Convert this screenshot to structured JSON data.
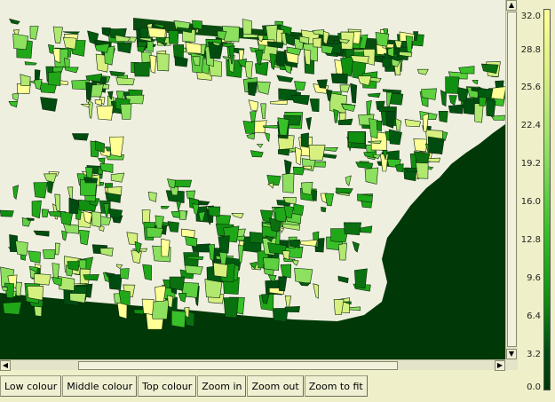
{
  "legend": {
    "ticks": [
      "32.0",
      "28.8",
      "25.6",
      "22.4",
      "19.2",
      "16.0",
      "12.8",
      "9.6",
      "6.4",
      "3.2",
      "0.0"
    ],
    "min": 0.0,
    "max": 32.0
  },
  "toolbar": {
    "low_colour": "Low colour",
    "middle_colour": "Middle colour",
    "top_colour": "Top colour",
    "zoom_in": "Zoom in",
    "zoom_out": "Zoom out",
    "zoom_to_fit": "Zoom to fit"
  },
  "scrollbar_icons": {
    "up": "▲",
    "down": "▼",
    "left": "◀",
    "right": "▶"
  },
  "colors": {
    "background": "#efefe0",
    "sea": "#003808",
    "low": "#ffff96",
    "high": "#003808"
  }
}
